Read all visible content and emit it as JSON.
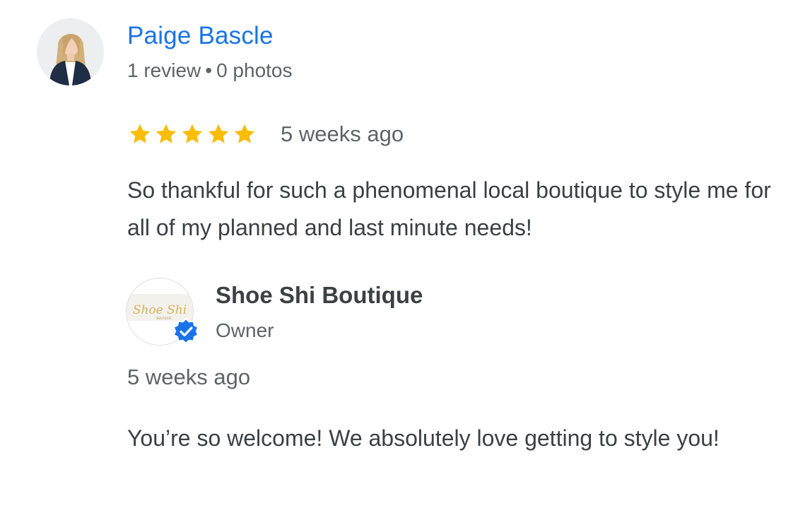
{
  "review": {
    "reviewer": {
      "name": "Paige Bascle",
      "review_count": "1 review",
      "separator": "•",
      "photo_count": "0 photos"
    },
    "rating": 5,
    "rating_max": 5,
    "star_color": "#fbbc04",
    "date": "5 weeks ago",
    "text": "So thankful for such a phenomenal local boutique to style me for all of my planned and last minute needs!"
  },
  "owner_reply": {
    "name": "Shoe Shi Boutique",
    "role": "Owner",
    "logo_text": "Shoe Shi",
    "logo_subtext": "BOUTIQUE",
    "verified_badge_color": "#1a73e8",
    "date": "5 weeks ago",
    "text": "You’re so welcome! We absolutely love getting to style you!"
  },
  "colors": {
    "link_blue": "#1a73e8",
    "body_text": "#3c4043",
    "secondary_text": "#5f6368"
  }
}
